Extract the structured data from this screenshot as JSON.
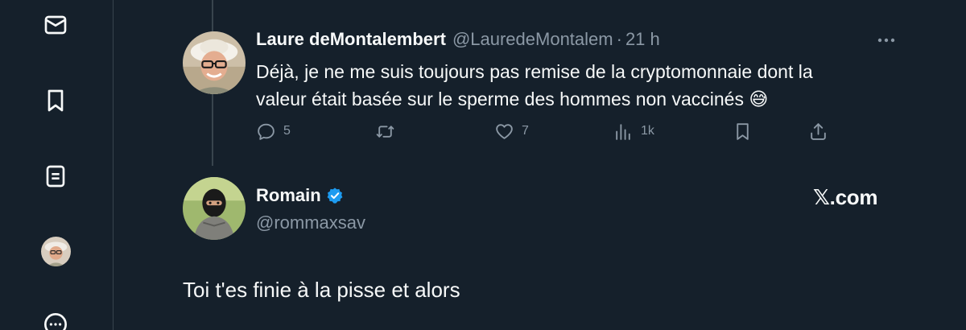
{
  "sidebar": {
    "items": [
      {
        "icon": "envelope-icon"
      },
      {
        "icon": "bookmark-icon"
      },
      {
        "icon": "lists-icon"
      },
      {
        "icon": "profile-avatar"
      },
      {
        "icon": "more-circle-icon"
      }
    ]
  },
  "tweet": {
    "display_name": "Laure deMontalembert",
    "handle": "@LauredeMontalem",
    "separator": "·",
    "time": "21 h",
    "text": "Déjà, je ne me suis toujours pas remise de la cryptomonnaie dont la valeur était basée sur le sperme des hommes non vaccinés 😅",
    "actions": {
      "replies": "5",
      "reposts": "",
      "likes": "7",
      "views": "1k"
    }
  },
  "reply": {
    "display_name": "Romain",
    "handle": "@rommaxsav",
    "watermark": "𝕏.com",
    "text": "Toi t'es finie à la pisse et alors"
  },
  "colors": {
    "background": "#15202b",
    "text": "#f7f9f9",
    "secondary": "#8b98a5",
    "divider": "#38444d",
    "verified": "#1d9bf0"
  }
}
